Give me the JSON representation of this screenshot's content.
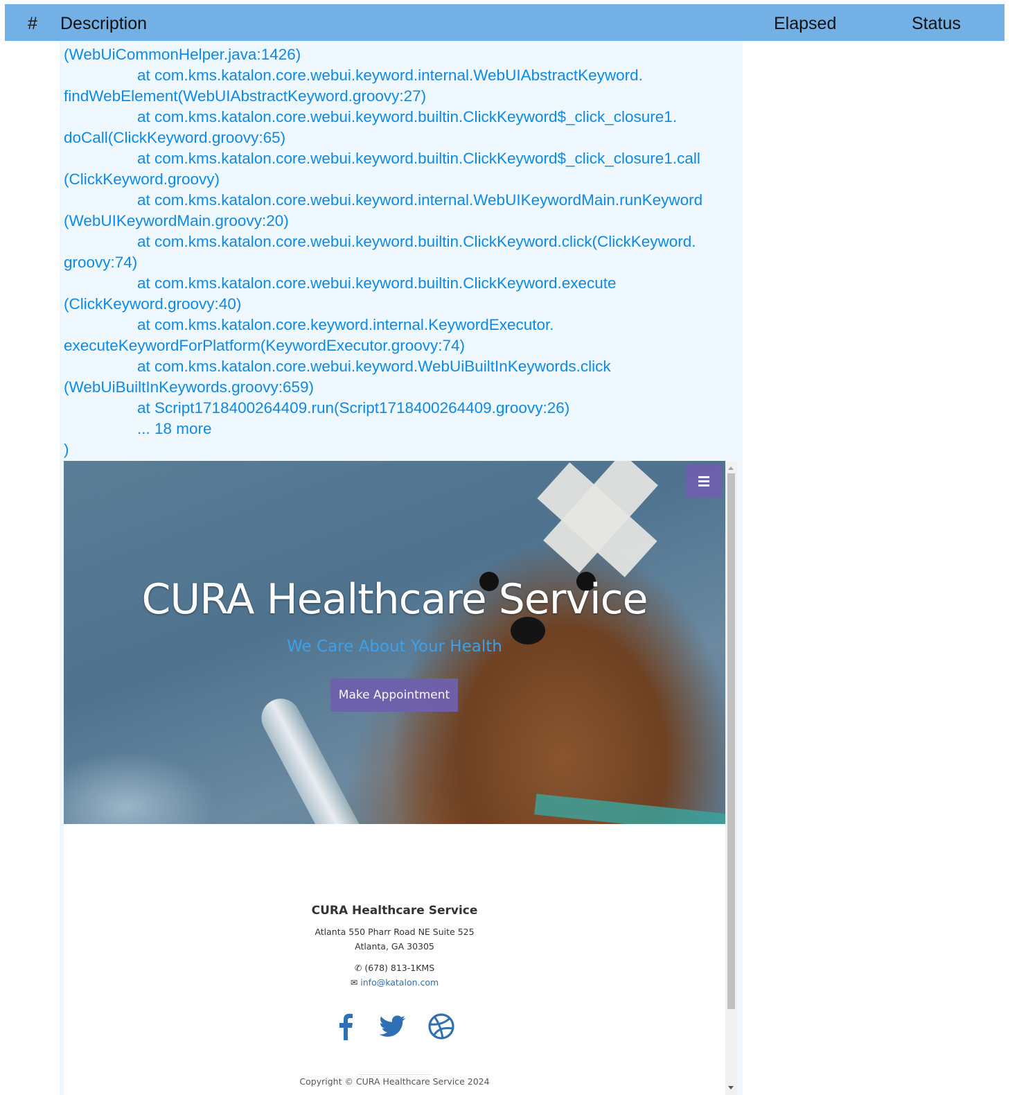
{
  "table_header": {
    "number": "#",
    "description": "Description",
    "elapsed": "Elapsed",
    "status": "Status"
  },
  "log_lines": [
    "(WebUiCommonHelper.java:1426)",
    "at com.kms.katalon.core.webui.keyword.internal.WebUIAbstractKeyword.",
    "findWebElement(WebUIAbstractKeyword.groovy:27)",
    "at com.kms.katalon.core.webui.keyword.builtin.ClickKeyword$_click_closure1.",
    "doCall(ClickKeyword.groovy:65)",
    "at com.kms.katalon.core.webui.keyword.builtin.ClickKeyword$_click_closure1.call",
    "(ClickKeyword.groovy)",
    "at com.kms.katalon.core.webui.keyword.internal.WebUIKeywordMain.runKeyword",
    "(WebUIKeywordMain.groovy:20)",
    "at com.kms.katalon.core.webui.keyword.builtin.ClickKeyword.click(ClickKeyword.",
    "groovy:74)",
    "at com.kms.katalon.core.webui.keyword.builtin.ClickKeyword.execute",
    "(ClickKeyword.groovy:40)",
    "at com.kms.katalon.core.keyword.internal.KeywordExecutor.",
    "executeKeywordForPlatform(KeywordExecutor.groovy:74)",
    "at com.kms.katalon.core.webui.keyword.WebUiBuiltInKeywords.click",
    "(WebUiBuiltInKeywords.groovy:659)",
    "at Script1718400264409.run(Script1718400264409.groovy:26)",
    "... 18 more",
    ")"
  ],
  "screenshot": {
    "hero_title": "CURA Healthcare Service",
    "hero_subtitle": "We Care About Your Health",
    "appointment_button": "Make Appointment",
    "menu_icon": "hamburger-menu-icon",
    "footer": {
      "title": "CURA Healthcare Service",
      "address_line1": "Atlanta 550 Pharr Road NE Suite 525",
      "address_line2": "Atlanta, GA 30305",
      "phone": "(678) 813-1KMS",
      "email": "info@katalon.com",
      "social_icons": [
        "facebook-icon",
        "twitter-icon",
        "dribbble-icon"
      ],
      "copyright": "Copyright © CURA Healthcare Service 2024"
    }
  },
  "colors": {
    "header_bg": "#73b0e5",
    "log_text": "#0c8ae6",
    "panel_bg": "#f0f8ff",
    "button_bg": "#6f60ad",
    "link": "#2f6fb4"
  }
}
